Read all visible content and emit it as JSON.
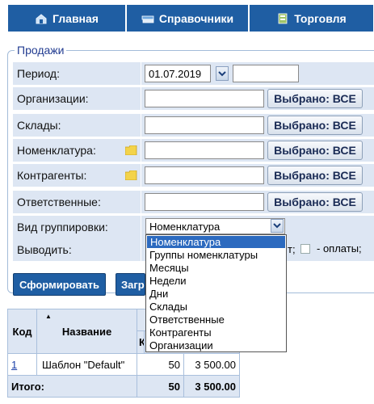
{
  "menu": {
    "tabs": [
      {
        "label": "Главная",
        "icon": "home-icon"
      },
      {
        "label": "Справочники",
        "icon": "books-icon"
      },
      {
        "label": "Торговля",
        "icon": "trade-icon"
      }
    ]
  },
  "form": {
    "legend": "Продажи",
    "rows": {
      "period": {
        "label": "Период:",
        "date_from": "01.07.2019",
        "date_to": ""
      },
      "orgs": {
        "label": "Организации:",
        "value": "",
        "button": "Выбрано: ВСЕ"
      },
      "stores": {
        "label": "Склады:",
        "value": "",
        "button": "Выбрано: ВСЕ"
      },
      "nomenclature": {
        "label": "Номенклатура:",
        "value": "",
        "button": "Выбрано: ВСЕ"
      },
      "partners": {
        "label": "Контрагенты:",
        "value": "",
        "button": "Выбрано: ВСЕ"
      },
      "responsible": {
        "label": "Ответственные:",
        "value": "",
        "button": "Выбрано: ВСЕ"
      },
      "grouping": {
        "label": "Вид группировки:",
        "selected": "Номенклатура"
      },
      "output": {
        "label": "Выводить:",
        "partial_text": "т;",
        "payments_text": "- оплаты;"
      }
    },
    "grouping_options": [
      "Номенклатура",
      "Группы номенклатуры",
      "Месяцы",
      "Недели",
      "Дни",
      "Склады",
      "Ответственные",
      "Контрагенты",
      "Организации"
    ],
    "buttons": {
      "submit": "Сформировать",
      "load_partial": "Загр"
    }
  },
  "results": {
    "headers": {
      "code": "Код",
      "name": "Название",
      "qty_partial": "К"
    },
    "rows": [
      {
        "code": "1",
        "name": "Шаблон \"Default\"",
        "qty": "50",
        "sum": "3 500.00"
      }
    ],
    "total": {
      "label": "Итого:",
      "qty": "50",
      "sum": "3 500.00"
    }
  }
}
